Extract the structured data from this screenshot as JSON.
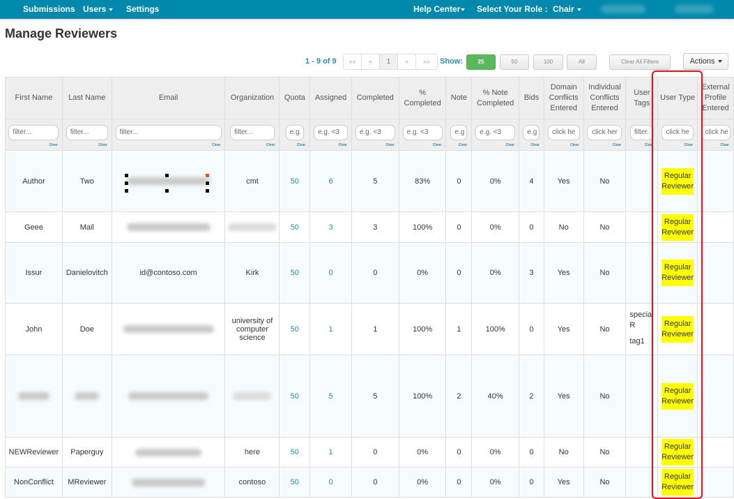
{
  "navbar": {
    "items": [
      {
        "label": "Submissions",
        "dropdown": false
      },
      {
        "label": "Users",
        "dropdown": true
      },
      {
        "label": "Settings",
        "dropdown": false
      }
    ],
    "help_center": "Help Center",
    "role_label": "Select Your Role :",
    "role_value": "Chair"
  },
  "page": {
    "title": "Manage Reviewers"
  },
  "toolbar": {
    "range_text": "1 - 9 of 9",
    "pager": [
      "««",
      "«",
      "1",
      "»",
      "»»"
    ],
    "current_page": "1",
    "show_label": "Show:",
    "page_sizes": [
      "25",
      "50",
      "100",
      "All"
    ],
    "active_page_size": "25",
    "clear_filters_label": "Clear All Filters",
    "actions_label": "Actions"
  },
  "table": {
    "columns": [
      {
        "label": "First Name",
        "filter": "filter..."
      },
      {
        "label": "Last Name",
        "filter": "filter..."
      },
      {
        "label": "Email",
        "filter": "filter..."
      },
      {
        "label": "Organization",
        "filter": "filter..."
      },
      {
        "label": "Quota",
        "filter": "e.g. <"
      },
      {
        "label": "Assigned",
        "filter": "e.g. <3"
      },
      {
        "label": "Completed",
        "filter": "e.g. <3"
      },
      {
        "label": "% Completed",
        "filter": "e.g. <3"
      },
      {
        "label": "Note",
        "filter": "e.g"
      },
      {
        "label": "% Note Completed",
        "filter": "e.g. <3"
      },
      {
        "label": "Bids",
        "filter": "e.g"
      },
      {
        "label": "Domain Conflicts Entered",
        "filter": "click he"
      },
      {
        "label": "Individual Conflicts Entered",
        "filter": "click her"
      },
      {
        "label": "User Tags",
        "filter": "filter."
      },
      {
        "label": "User Type",
        "filter": "click he"
      },
      {
        "label": "External Profile Entered",
        "filter": "click he"
      }
    ],
    "clear_label": "Clear",
    "rows": [
      {
        "first": "Author",
        "last": "Two",
        "email": "[redacted]",
        "org": "cmt",
        "quota": "50",
        "assigned": "6",
        "completed": "5",
        "pct_completed": "83%",
        "note": "0",
        "pct_note": "0%",
        "bids": "4",
        "domain_conflicts": "Yes",
        "individual_conflicts": "No",
        "tags": [],
        "user_type": "Regular Reviewer",
        "external_profile": ""
      },
      {
        "first": "Geee",
        "last": "Mail",
        "email": "[redacted]",
        "org": "[redacted]",
        "quota": "50",
        "assigned": "3",
        "completed": "3",
        "pct_completed": "100%",
        "note": "0",
        "pct_note": "0%",
        "bids": "0",
        "domain_conflicts": "No",
        "individual_conflicts": "No",
        "tags": [],
        "user_type": "Regular Reviewer",
        "external_profile": ""
      },
      {
        "first": "Issur",
        "last": "Danielovitch",
        "email": "id@contoso.com",
        "org": "Kirk",
        "quota": "50",
        "assigned": "0",
        "completed": "0",
        "pct_completed": "0%",
        "note": "0",
        "pct_note": "0%",
        "bids": "3",
        "domain_conflicts": "Yes",
        "individual_conflicts": "No",
        "tags": [],
        "user_type": "Regular Reviewer",
        "external_profile": ""
      },
      {
        "first": "John",
        "last": "Doe",
        "email": "[redacted]",
        "org": "university of computer science",
        "quota": "50",
        "assigned": "1",
        "completed": "1",
        "pct_completed": "100%",
        "note": "1",
        "pct_note": "100%",
        "bids": "0",
        "domain_conflicts": "Yes",
        "individual_conflicts": "No",
        "tags": [
          "special R",
          "tag1"
        ],
        "user_type": "Regular Reviewer",
        "external_profile": ""
      },
      {
        "first": "[redacted]",
        "last": "[redacted]",
        "email": "[redacted]",
        "org": "[redacted]",
        "quota": "50",
        "assigned": "5",
        "completed": "5",
        "pct_completed": "100%",
        "note": "2",
        "pct_note": "40%",
        "bids": "2",
        "domain_conflicts": "Yes",
        "individual_conflicts": "No",
        "tags": [],
        "user_type": "Regular Reviewer",
        "external_profile": ""
      },
      {
        "first": "NEWReviewer",
        "last": "Paperguy",
        "email": "[redacted]",
        "org": "here",
        "quota": "50",
        "assigned": "1",
        "completed": "0",
        "pct_completed": "0%",
        "note": "0",
        "pct_note": "0%",
        "bids": "0",
        "domain_conflicts": "No",
        "individual_conflicts": "No",
        "tags": [],
        "user_type": "Regular Reviewer",
        "external_profile": ""
      },
      {
        "first": "NonConflict",
        "last": "MReviewer",
        "email": "[redacted]",
        "org": "contoso",
        "quota": "50",
        "assigned": "0",
        "completed": "0",
        "pct_completed": "0%",
        "note": "0",
        "pct_note": "0%",
        "bids": "0",
        "domain_conflicts": "Yes",
        "individual_conflicts": "No",
        "tags": [],
        "user_type": "Regular Reviewer",
        "external_profile": ""
      }
    ]
  },
  "colors": {
    "navbar": "#0089ad",
    "link": "#2a8ab6",
    "active_page_size": "#5cb85c",
    "user_type_highlight": "#ffff00",
    "annotation_border": "#e8141c",
    "row_shade": "#f5fbfe"
  }
}
